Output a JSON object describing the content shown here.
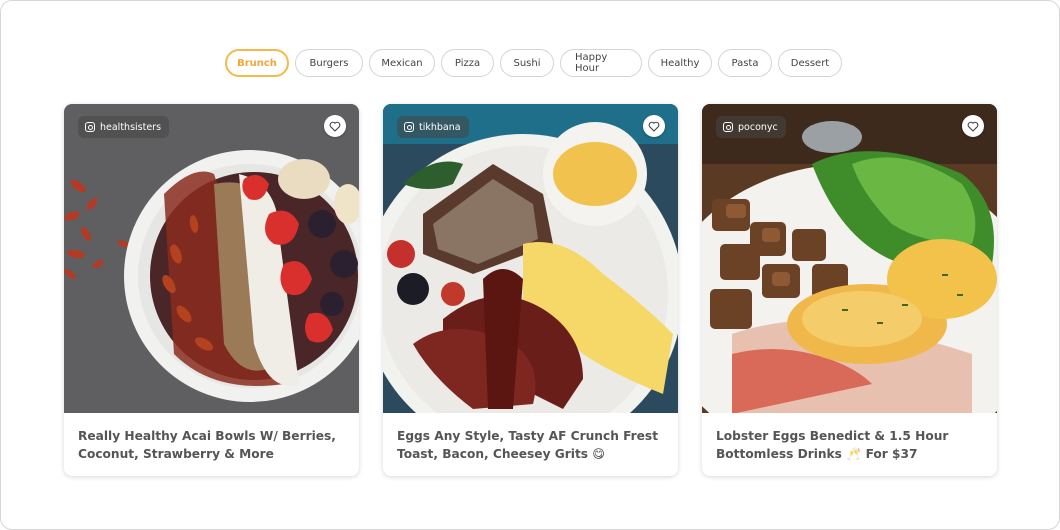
{
  "filters": [
    {
      "label": "Brunch",
      "active": true
    },
    {
      "label": "Burgers",
      "active": false
    },
    {
      "label": "Mexican",
      "active": false
    },
    {
      "label": "Pizza",
      "active": false
    },
    {
      "label": "Sushi",
      "active": false
    },
    {
      "label": "Happy Hour",
      "active": false
    },
    {
      "label": "Healthy",
      "active": false
    },
    {
      "label": "Pasta",
      "active": false
    },
    {
      "label": "Dessert",
      "active": false
    }
  ],
  "cards": [
    {
      "handle": "healthsisters",
      "title": "Really Healthy Acai Bowls W/ Berries, Coconut, Strawberry & More",
      "image": "acai-bowl-photo"
    },
    {
      "handle": "tikhbana",
      "title": "Eggs Any Style, Tasty AF Crunch Frest Toast, Bacon, Cheesey Grits 😋",
      "image": "french-toast-bacon-photo"
    },
    {
      "handle": "poconyc",
      "title": "Lobster Eggs Benedict & 1.5 Hour Bottomless Drinks 🥂 For $37",
      "image": "eggs-benedict-photo"
    }
  ],
  "colors": {
    "accent": "#f5b94a",
    "accent_text": "#f0a63a"
  },
  "icons": {
    "handle": "instagram-icon",
    "save": "heart-icon"
  }
}
